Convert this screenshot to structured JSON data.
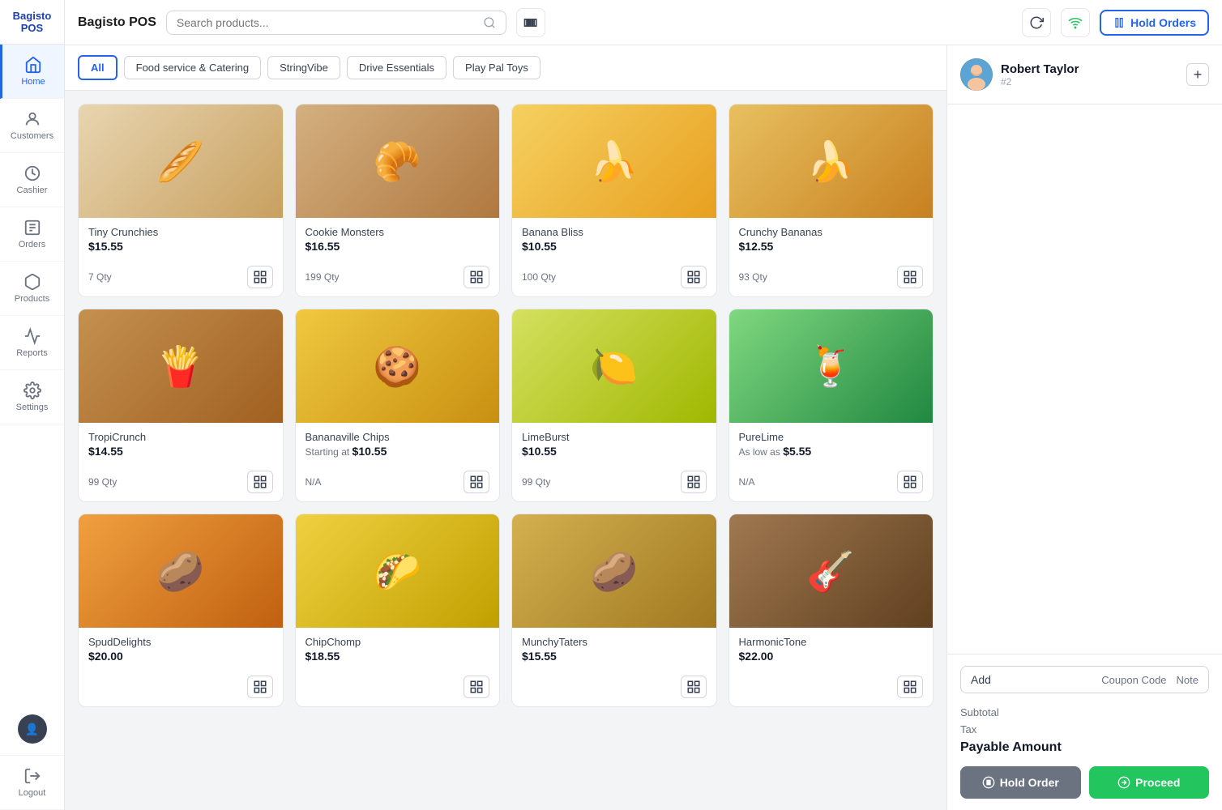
{
  "app": {
    "name": "Bagisto POS"
  },
  "header": {
    "search_placeholder": "Search products...",
    "hold_orders_label": "Hold Orders"
  },
  "sidebar": {
    "items": [
      {
        "id": "home",
        "label": "Home",
        "icon": "home-icon",
        "active": true
      },
      {
        "id": "customers",
        "label": "Customers",
        "icon": "customers-icon",
        "active": false
      },
      {
        "id": "cashier",
        "label": "Cashier",
        "icon": "cashier-icon",
        "active": false
      },
      {
        "id": "orders",
        "label": "Orders",
        "icon": "orders-icon",
        "active": false
      },
      {
        "id": "products",
        "label": "Products",
        "icon": "products-icon",
        "active": false
      },
      {
        "id": "reports",
        "label": "Reports",
        "icon": "reports-icon",
        "active": false
      },
      {
        "id": "settings",
        "label": "Settings",
        "icon": "settings-icon",
        "active": false
      }
    ]
  },
  "categories": {
    "tabs": [
      {
        "id": "all",
        "label": "All",
        "active": true
      },
      {
        "id": "food-catering",
        "label": "Food service & Catering",
        "active": false
      },
      {
        "id": "stringvibe",
        "label": "StringVibe",
        "active": false
      },
      {
        "id": "drive-essentials",
        "label": "Drive Essentials",
        "active": false
      },
      {
        "id": "play-pal-toys",
        "label": "Play Pal Toys",
        "active": false
      }
    ]
  },
  "products": [
    {
      "id": 1,
      "name": "Tiny Crunchies",
      "price": "$15.55",
      "price_prefix": "",
      "qty": "7 Qty",
      "color": "#c8a96e"
    },
    {
      "id": 2,
      "name": "Cookie Monsters",
      "price": "$16.55",
      "price_prefix": "",
      "qty": "199 Qty",
      "color": "#b8956e"
    },
    {
      "id": 3,
      "name": "Banana Bliss",
      "price": "$10.55",
      "price_prefix": "",
      "qty": "100 Qty",
      "color": "#e8c44e"
    },
    {
      "id": 4,
      "name": "Crunchy Bananas",
      "price": "$12.55",
      "price_prefix": "",
      "qty": "93 Qty",
      "color": "#d4a030"
    },
    {
      "id": 5,
      "name": "TropiCrunch",
      "price": "$14.55",
      "price_prefix": "",
      "qty": "99 Qty",
      "color": "#c49050"
    },
    {
      "id": 6,
      "name": "Bananaville Chips",
      "price": "$10.55",
      "price_prefix": "Starting at ",
      "qty": "N/A",
      "color": "#e0b840"
    },
    {
      "id": 7,
      "name": "LimeBurst",
      "price": "$10.55",
      "price_prefix": "",
      "qty": "99 Qty",
      "color": "#d4c840"
    },
    {
      "id": 8,
      "name": "PureLime",
      "price": "$5.55",
      "price_prefix": "As low as ",
      "qty": "N/A",
      "color": "#40a860"
    },
    {
      "id": 9,
      "name": "SpudDelights",
      "price": "$20.00",
      "price_prefix": "",
      "qty": "",
      "color": "#e89030"
    },
    {
      "id": 10,
      "name": "ChipChomp",
      "price": "$18.55",
      "price_prefix": "",
      "qty": "",
      "color": "#e8c030"
    },
    {
      "id": 11,
      "name": "MunchyTaters",
      "price": "$15.55",
      "price_prefix": "",
      "qty": "",
      "color": "#c8a850"
    },
    {
      "id": 12,
      "name": "HarmonicTone",
      "price": "$22.00",
      "price_prefix": "",
      "qty": "",
      "color": "#8b6040"
    }
  ],
  "cart": {
    "user": {
      "name": "Robert Taylor",
      "id": "#2"
    },
    "add_label": "Add",
    "coupon_code_label": "Coupon Code",
    "note_label": "Note",
    "subtotal_label": "Subtotal",
    "subtotal_value": "",
    "tax_label": "Tax",
    "tax_value": "",
    "payable_label": "Payable Amount",
    "payable_value": "",
    "hold_order_label": "Hold Order",
    "proceed_label": "Proceed"
  }
}
